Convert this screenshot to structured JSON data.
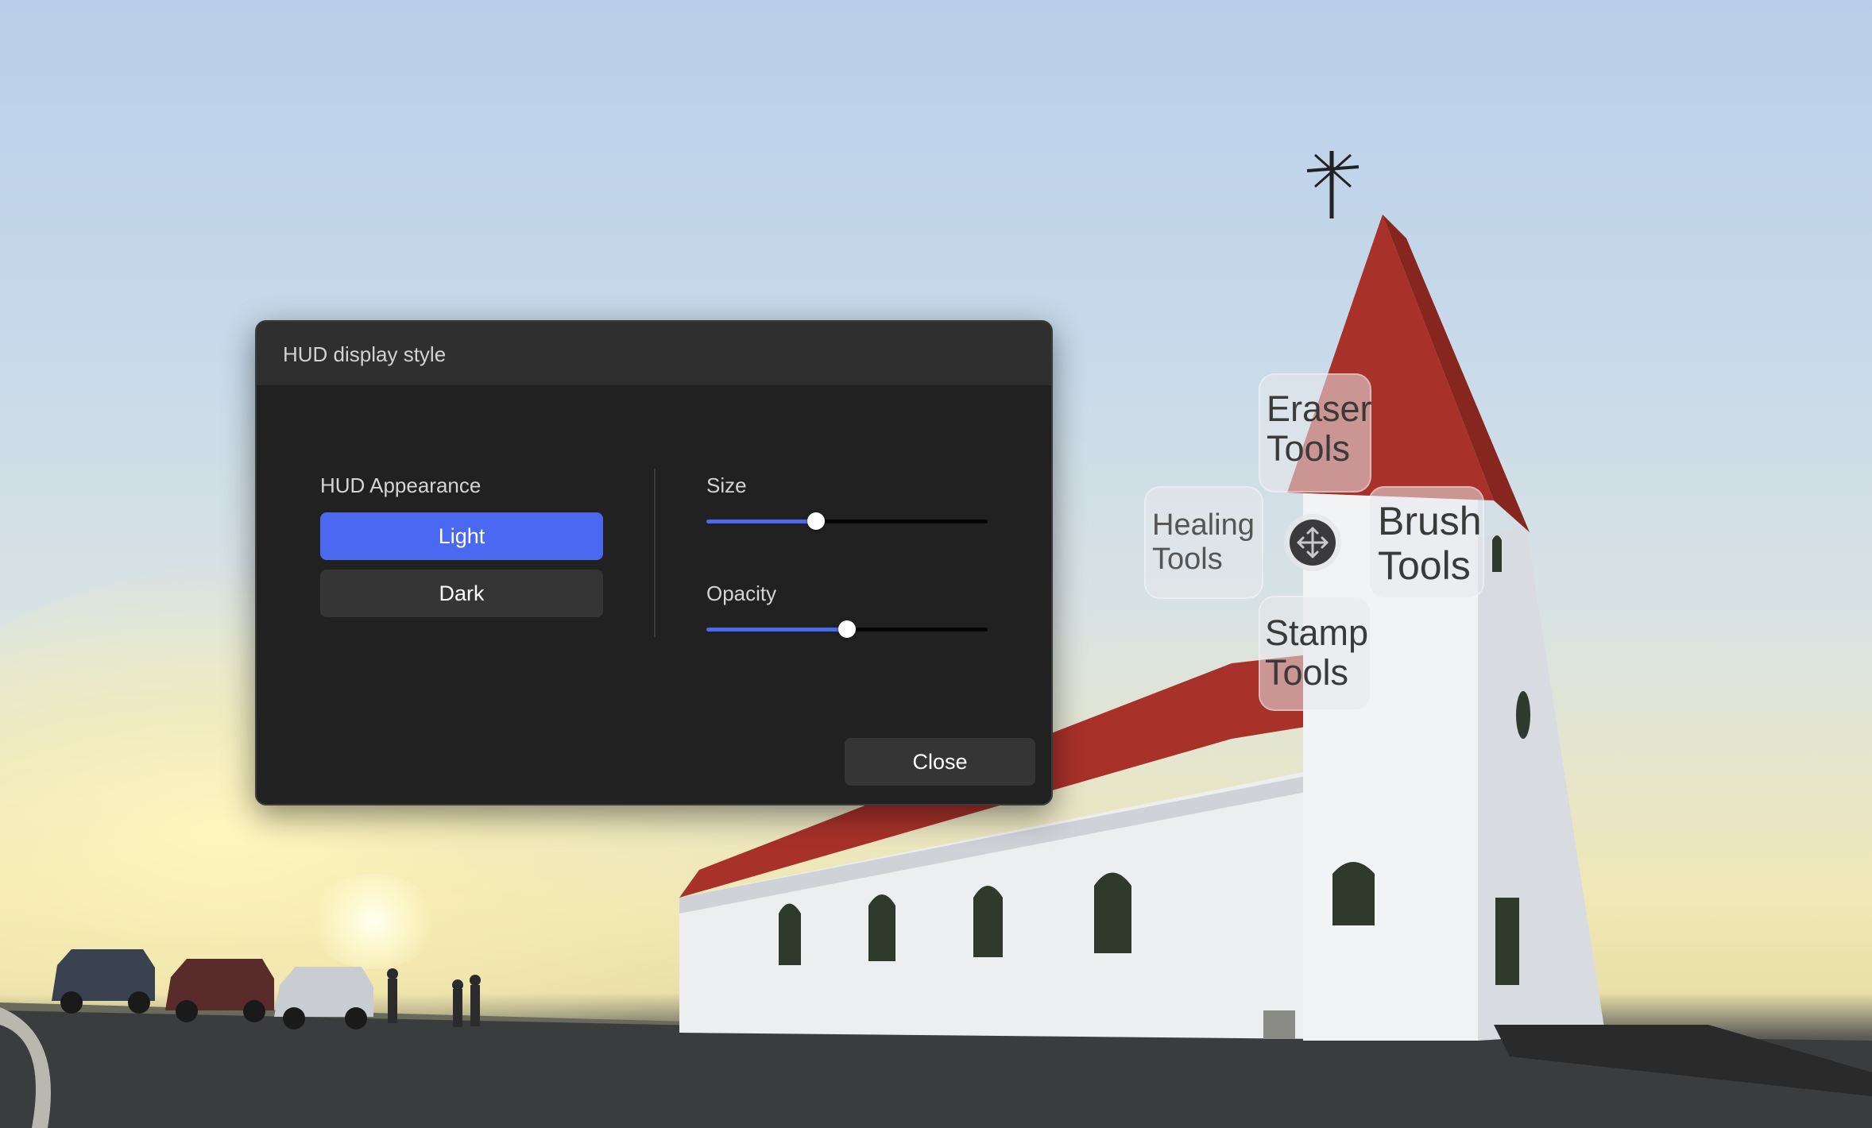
{
  "dialog": {
    "title": "HUD display style",
    "appearance": {
      "label": "HUD Appearance",
      "options": [
        "Light",
        "Dark"
      ],
      "selected": "Light"
    },
    "size": {
      "label": "Size",
      "value": 0.39
    },
    "opacity": {
      "label": "Opacity",
      "value": 0.5
    },
    "close_label": "Close"
  },
  "hud": {
    "eraser": [
      "Eraser",
      "Tools"
    ],
    "healing": [
      "Healing",
      "Tools"
    ],
    "brush": [
      "Brush",
      "Tools"
    ],
    "stamp": [
      "Stamp",
      "Tools"
    ],
    "center_icon": "move-arrows-icon"
  },
  "colors": {
    "accent": "#4b69f0",
    "dialog_bg": "#212121",
    "titlebar_bg": "#2f2f2f",
    "button_bg": "#353535",
    "roof_red": "#a8312a"
  }
}
